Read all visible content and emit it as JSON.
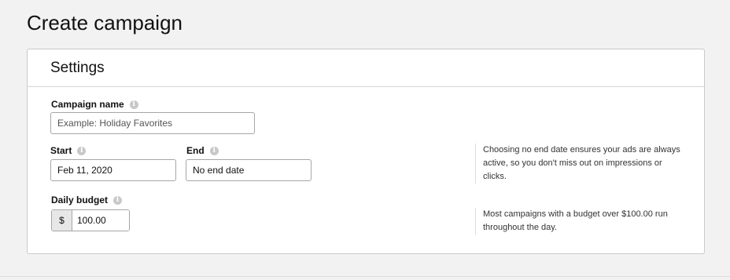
{
  "page": {
    "title": "Create campaign"
  },
  "settings": {
    "title": "Settings",
    "campaign_name": {
      "label": "Campaign name",
      "placeholder": "Example: Holiday Favorites",
      "value": ""
    },
    "start": {
      "label": "Start",
      "value": "Feb 11, 2020"
    },
    "end": {
      "label": "End",
      "value": "No end date"
    },
    "end_help": "Choosing no end date ensures your ads are always active, so you don't miss out on impressions or clicks.",
    "daily_budget": {
      "label": "Daily budget",
      "currency": "$",
      "value": "100.00"
    },
    "budget_help": "Most campaigns with a budget over $100.00 run throughout the day."
  },
  "icons": {
    "info": "info-circle-icon",
    "info_glyph": "i"
  },
  "colors": {
    "page_background": "#f2f2f2",
    "card_background": "#ffffff",
    "border": "#c9c9c9",
    "info_icon": "#c8c8c8",
    "currency_prefix_bg": "#e7e7e7"
  }
}
